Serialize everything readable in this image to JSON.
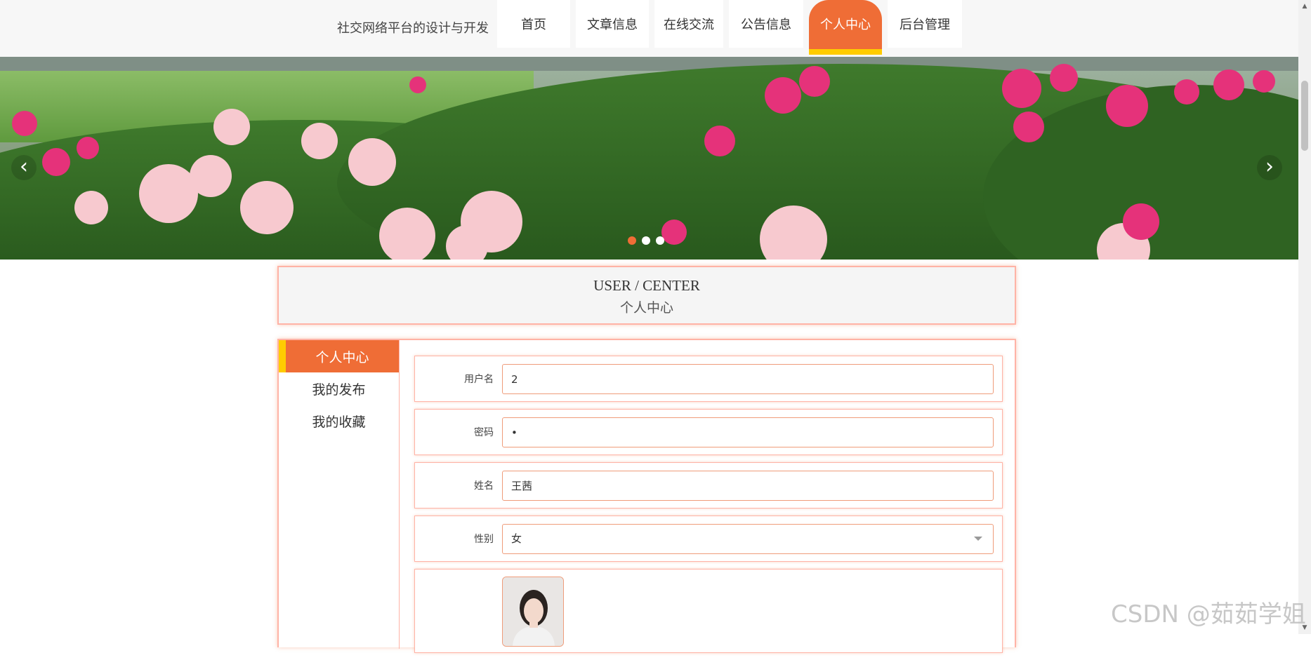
{
  "header": {
    "site_title": "社交网络平台的设计与开发",
    "nav": [
      {
        "label": "首页",
        "active": false
      },
      {
        "label": "文章信息",
        "active": false
      },
      {
        "label": "在线交流",
        "active": false
      },
      {
        "label": "公告信息",
        "active": false
      },
      {
        "label": "个人中心",
        "active": true
      },
      {
        "label": "后台管理",
        "active": false
      }
    ]
  },
  "banner": {
    "slide_count": 3,
    "active_slide": 1,
    "prev_icon": "chevron-left-icon",
    "next_icon": "chevron-right-icon"
  },
  "section_title": {
    "en": "USER / CENTER",
    "cn": "个人中心"
  },
  "sidebar": {
    "items": [
      {
        "label": "个人中心",
        "active": true
      },
      {
        "label": "我的发布",
        "active": false
      },
      {
        "label": "我的收藏",
        "active": false
      }
    ]
  },
  "form": {
    "username": {
      "label": "用户名",
      "value": "2"
    },
    "password": {
      "label": "密码",
      "value": "•"
    },
    "name": {
      "label": "姓名",
      "value": "王茜"
    },
    "gender": {
      "label": "性别",
      "value": "女"
    },
    "avatar": {
      "label": ""
    }
  },
  "watermark": "CSDN @茹茹学姐",
  "colors": {
    "accent": "#ef6d36",
    "accent_underline": "#ffcc00",
    "border": "#ffb3a6"
  }
}
